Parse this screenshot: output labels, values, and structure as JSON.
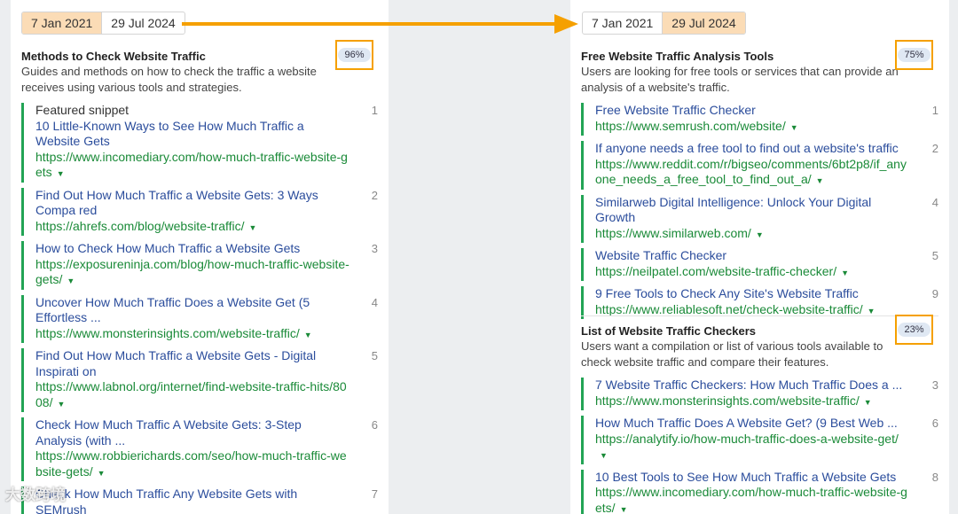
{
  "left": {
    "dates": [
      {
        "label": "7 Jan 2021",
        "active": true
      },
      {
        "label": "29 Jul 2024",
        "active": false
      }
    ],
    "cluster": {
      "title": "Methods to Check Website Traffic",
      "description": "Guides and methods on how to check the traffic a website receives using various tools and strategies.",
      "percent": "96%"
    },
    "results": [
      {
        "snippet": "Featured snippet",
        "title": "10 Little-Known Ways to See How Much Traffic a Website Gets",
        "url": "https://www.incomediary.com/how-much-traffic-website-gets",
        "rank": "1"
      },
      {
        "title": "Find Out How Much Traffic a Website Gets: 3 Ways Compa red",
        "url": "https://ahrefs.com/blog/website-traffic/",
        "rank": "2"
      },
      {
        "title": "How to Check How Much Traffic a Website Gets",
        "url": "https://exposureninja.com/blog/how-much-traffic-website-gets/",
        "rank": "3"
      },
      {
        "title": "Uncover How Much Traffic Does a Website Get (5 Effortless ...",
        "url": "https://www.monsterinsights.com/website-traffic/",
        "rank": "4"
      },
      {
        "title": "Find Out How Much Traffic a Website Gets - Digital Inspirati on",
        "url": "https://www.labnol.org/internet/find-website-traffic-hits/8008/",
        "rank": "5"
      },
      {
        "title": "Check How Much Traffic A Website Gets: 3-Step Analysis (with ...",
        "url": "https://www.robbierichards.com/seo/how-much-traffic-website-gets/",
        "rank": "6"
      },
      {
        "title": "Check How Much Traffic Any Website Gets with SEMrush",
        "url": "",
        "rank": "7"
      }
    ]
  },
  "right": {
    "dates": [
      {
        "label": "7 Jan 2021",
        "active": false
      },
      {
        "label": "29 Jul 2024",
        "active": true
      }
    ],
    "clusters": [
      {
        "title": "Free Website Traffic Analysis Tools",
        "description": "Users are looking for free tools or services that can provide an analysis of a website's traffic.",
        "percent": "75%",
        "results": [
          {
            "title": "Free Website Traffic Checker",
            "url": "https://www.semrush.com/website/",
            "rank": "1"
          },
          {
            "title": "If anyone needs a free tool to find out a website's traffic",
            "url": "https://www.reddit.com/r/bigseo/comments/6bt2p8/if_anyone_needs_a_free_tool_to_find_out_a/",
            "rank": "2"
          },
          {
            "title": "Similarweb Digital Intelligence: Unlock Your Digital Growth",
            "url": "https://www.similarweb.com/",
            "rank": "4"
          },
          {
            "title": "Website Traffic Checker",
            "url": "https://neilpatel.com/website-traffic-checker/",
            "rank": "5"
          },
          {
            "title": "9 Free Tools to Check Any Site's Website Traffic",
            "url": "https://www.reliablesoft.net/check-website-traffic/",
            "rank": "9"
          }
        ]
      },
      {
        "title": "List of Website Traffic Checkers",
        "description": "Users want a compilation or list of various tools available to check website traffic and compare their features.",
        "percent": "23%",
        "results": [
          {
            "title": "7 Website Traffic Checkers: How Much Traffic Does a ...",
            "url": "https://www.monsterinsights.com/website-traffic/",
            "rank": "3"
          },
          {
            "title": "How Much Traffic Does A Website Get? (9 Best Web ...",
            "url": "https://analytify.io/how-much-traffic-does-a-website-get/",
            "rank": "6"
          },
          {
            "title": "10 Best Tools to See How Much Traffic a Website Gets",
            "url": "https://www.incomediary.com/how-much-traffic-website-gets/",
            "rank": "8"
          }
        ]
      }
    ]
  },
  "icons": {
    "caret": "▼"
  },
  "colors": {
    "highlight": "#f5a000",
    "result_bar": "#22a455",
    "title_link": "#2b4d9c",
    "url": "#1a8a38",
    "active_date": "#fbdcb6"
  },
  "watermark": "大数跨境"
}
